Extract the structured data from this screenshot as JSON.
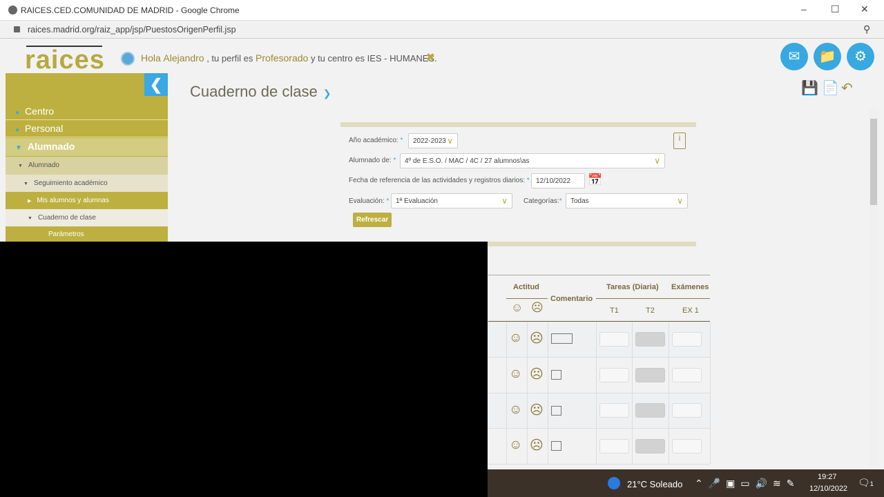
{
  "browser": {
    "title": "RAICES.CED.COMUNIDAD DE MADRID - Google Chrome",
    "url": "raices.madrid.org/raiz_app/jsp/PuestosOrigenPerfil.jsp"
  },
  "header": {
    "logo": "raices",
    "greeting_prefix": "Hola",
    "user": "Alejandro",
    "mid": ", tu perfil es",
    "profile": "Profesorado",
    "suffix": "y tu centro es IES - HUMANES."
  },
  "sidebar": {
    "items": [
      "Centro",
      "Personal",
      "Alumnado",
      "Alumnado",
      "Seguimiento académico",
      "Mis alumnos y alumnas",
      "Cuaderno de clase",
      "Parámetros"
    ]
  },
  "page": {
    "title": "Cuaderno de clase"
  },
  "form": {
    "year_label": "Año académico:",
    "year_value": "2022-2023",
    "group_label": "Alumnado de:",
    "group_value": "4º de E.S.O. / MAC / 4C / 27 alumnos\\as",
    "date_label": "Fecha de referencia de las actividades y registros diarios:",
    "date_value": "12/10/2022",
    "eval_label": "Evaluación:",
    "eval_value": "1ª Evaluación",
    "cat_label": "Categorías:",
    "cat_value": "Todas",
    "refresh": "Refrescar"
  },
  "table": {
    "actitud": "Actitud",
    "comentario": "Comentario",
    "tareas": "Tareas (Diaria)",
    "examenes": "Exámenes",
    "t1": "T1",
    "t2": "T2",
    "ex1": "EX 1"
  },
  "taskbar": {
    "weather": "21°C  Soleado",
    "time": "19:27",
    "date": "12/10/2022",
    "notifications": "1"
  }
}
